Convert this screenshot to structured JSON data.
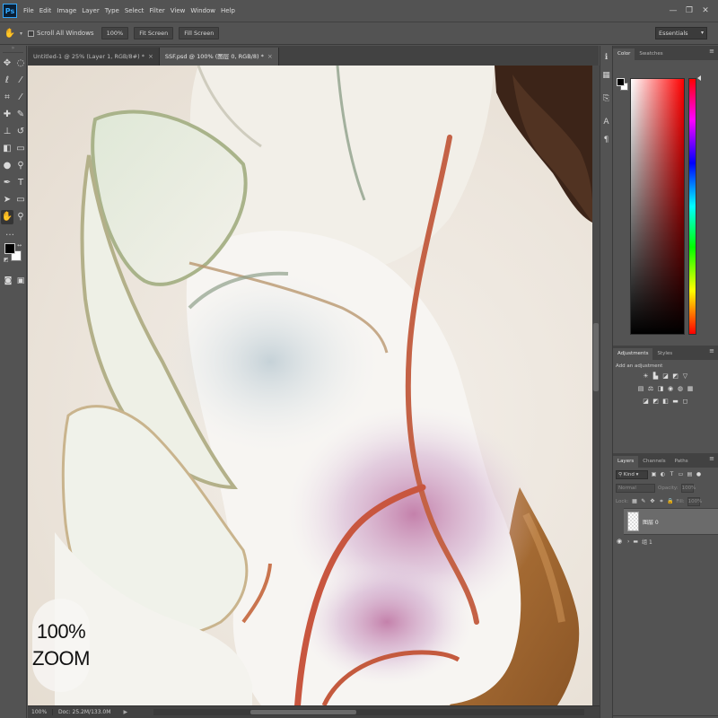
{
  "app": {
    "logo": "Ps"
  },
  "menu": [
    "File",
    "Edit",
    "Image",
    "Layer",
    "Type",
    "Select",
    "Filter",
    "View",
    "Window",
    "Help"
  ],
  "window_controls": {
    "minimize": "—",
    "restore": "❐",
    "close": "✕"
  },
  "options_bar": {
    "tool_icon": "hand-icon",
    "scroll_all_label": "Scroll All Windows",
    "buttons": [
      "100%",
      "Fit Screen",
      "Fill Screen"
    ],
    "workspace": "Essentials"
  },
  "tabs": [
    {
      "label": "Untitled-1 @ 25% (Layer 1, RGB/8#) *",
      "active": false
    },
    {
      "label": "SSF.psd @ 100% (图层 0, RGB/8) *",
      "active": true
    }
  ],
  "canvas": {
    "zoom_badge_lines": [
      "100%",
      "ZOOM"
    ]
  },
  "status_bar": {
    "zoom": "100%",
    "doc": "Doc: 25.2M/133.0M"
  },
  "panels": {
    "color_tabs": [
      "Color",
      "Swatches"
    ],
    "adjust_tabs": [
      "Adjustments",
      "Styles"
    ],
    "adjust_title": "Add an adjustment",
    "layers_tabs": [
      "Layers",
      "Channels",
      "Paths"
    ],
    "layers_kind": "Kind",
    "blend_mode": "Normal",
    "opacity_label": "Opacity:",
    "opacity_value": "100%",
    "lock_label": "Lock:",
    "fill_label": "Fill:",
    "fill_value": "100%",
    "layer_name": "图层 0",
    "group_name": "组 1"
  },
  "colors": {
    "foreground": "#000000",
    "background": "#ffffff",
    "panel_bg": "#535353",
    "dark_bg": "#424242"
  }
}
